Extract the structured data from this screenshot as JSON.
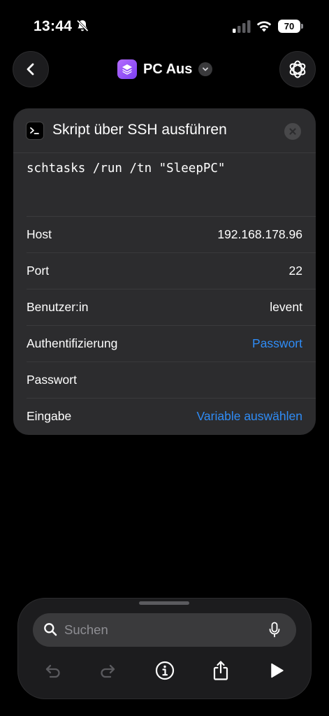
{
  "status_bar": {
    "time": "13:44",
    "battery": "70",
    "icons": [
      "bell-slash-icon",
      "cellular-signal-icon",
      "wifi-icon",
      "battery-icon"
    ]
  },
  "nav": {
    "title": "PC Aus",
    "icons": [
      "back-chevron-icon",
      "shortcut-layers-icon",
      "chevron-down-icon",
      "settings-flower-icon"
    ]
  },
  "action": {
    "title": "Skript über SSH ausführen",
    "script": "schtasks /run /tn \"SleepPC\"",
    "icons": [
      "terminal-icon",
      "close-icon"
    ],
    "rows": [
      {
        "label": "Host",
        "value": "192.168.178.96"
      },
      {
        "label": "Port",
        "value": "22"
      },
      {
        "label": "Benutzer:in",
        "value": "levent"
      },
      {
        "label": "Authentifizierung",
        "value": "Passwort"
      },
      {
        "label": "Passwort",
        "value": ""
      },
      {
        "label": "Eingabe",
        "value": "Variable auswählen"
      }
    ]
  },
  "toolbar": {
    "search_placeholder": "Suchen",
    "icons": [
      "search-icon",
      "microphone-icon",
      "undo-icon",
      "redo-icon",
      "info-icon",
      "share-icon",
      "play-icon"
    ]
  },
  "colors": {
    "background": "#000000",
    "card": "#2c2c2e",
    "accent_link": "#2f8cf6",
    "app_icon": "#9b59f5"
  }
}
